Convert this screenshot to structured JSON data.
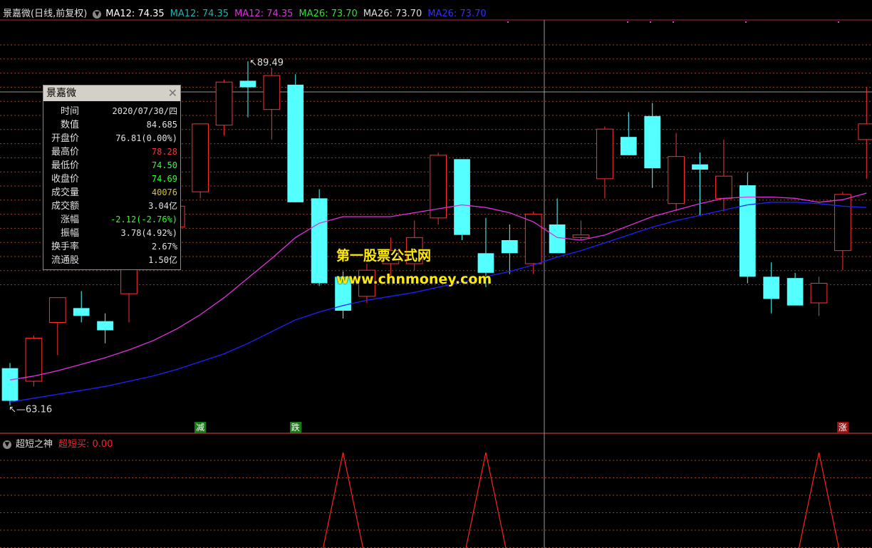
{
  "header": {
    "title": "景嘉微(日线,前复权)",
    "ma12_white": "MA12: 74.35",
    "ma12_teal": "MA12: 74.35",
    "ma12_magenta": "MA12: 74.35",
    "ma26_green": "MA26: 73.70",
    "ma26_white": "MA26: 73.70",
    "ma26_blue": "MA26: 73.70"
  },
  "colors": {
    "up": "#ff3030",
    "down": "#54ffff",
    "ma12": "#e030e0",
    "ma26": "#2020ff",
    "grid": "#9c4020",
    "indicator": "#ff2020"
  },
  "info_panel": {
    "title": "景嘉微",
    "rows": [
      {
        "label": "时间",
        "value": "2020/07/30/四",
        "color": "#e0e0e0"
      },
      {
        "label": "数值",
        "value": "84.685",
        "color": "#e0e0e0"
      },
      {
        "label": "开盘价",
        "value": "76.81(0.00%)",
        "color": "#e0e0e0"
      },
      {
        "label": "最高价",
        "value": "78.28",
        "color": "#ff3030"
      },
      {
        "label": "最低价",
        "value": "74.50",
        "color": "#30ff30"
      },
      {
        "label": "收盘价",
        "value": "74.69",
        "color": "#30ff30"
      },
      {
        "label": "成交量",
        "value": "40076",
        "color": "#e0c020"
      },
      {
        "label": "成交额",
        "value": "3.04亿",
        "color": "#e0e0e0"
      },
      {
        "label": "涨幅",
        "value": "-2.12(-2.76%)",
        "color": "#30ff30"
      },
      {
        "label": "振幅",
        "value": "3.78(4.92%)",
        "color": "#e0e0e0"
      },
      {
        "label": "换手率",
        "value": "2.67%",
        "color": "#e0e0e0"
      },
      {
        "label": "流通股",
        "value": "1.50亿",
        "color": "#e0e0e0"
      }
    ]
  },
  "annotations": {
    "high": "89.49",
    "low": "63.16"
  },
  "signals": [
    {
      "text": "减",
      "bg": "#1a7a1a",
      "index": 8
    },
    {
      "text": "跌",
      "bg": "#1a7a1a",
      "index": 12
    },
    {
      "text": "涨",
      "bg": "#a01010",
      "index": 35
    }
  ],
  "watermark": {
    "line1": "第一股票公式网",
    "line2": "www.chnmoney.com"
  },
  "indicator": {
    "name": "超短之神",
    "signal_label": "超短买: 0.00"
  },
  "chart_data": {
    "type": "candlestick",
    "candles": [
      {
        "o": 66.0,
        "h": 66.4,
        "l": 63.16,
        "c": 63.5
      },
      {
        "o": 65.0,
        "h": 68.5,
        "l": 64.6,
        "c": 68.3
      },
      {
        "o": 69.5,
        "h": 70.1,
        "l": 67.0,
        "c": 71.4
      },
      {
        "o": 70.6,
        "h": 71.9,
        "l": 69.5,
        "c": 70.0
      },
      {
        "o": 69.6,
        "h": 70.2,
        "l": 67.9,
        "c": 68.9
      },
      {
        "o": 71.7,
        "h": 75.0,
        "l": 69.5,
        "c": 74.7
      },
      {
        "o": 75.5,
        "h": 78.8,
        "l": 75.0,
        "c": 75.7
      },
      {
        "o": 76.8,
        "h": 78.3,
        "l": 74.5,
        "c": 78.4
      },
      {
        "o": 79.5,
        "h": 83.8,
        "l": 79.0,
        "c": 84.7
      },
      {
        "o": 84.6,
        "h": 88.1,
        "l": 83.8,
        "c": 87.9
      },
      {
        "o": 88.0,
        "h": 89.49,
        "l": 85.2,
        "c": 87.5
      },
      {
        "o": 85.8,
        "h": 89.0,
        "l": 83.5,
        "c": 88.4
      },
      {
        "o": 87.7,
        "h": 88.5,
        "l": 78.9,
        "c": 78.7
      },
      {
        "o": 79.0,
        "h": 79.7,
        "l": 72.3,
        "c": 72.5
      },
      {
        "o": 73.0,
        "h": 73.4,
        "l": 69.8,
        "c": 70.4
      },
      {
        "o": 71.5,
        "h": 74.0,
        "l": 71.0,
        "c": 73.5
      },
      {
        "o": 74.0,
        "h": 76.0,
        "l": 73.0,
        "c": 75.0
      },
      {
        "o": 74.0,
        "h": 77.3,
        "l": 73.5,
        "c": 76.0
      },
      {
        "o": 77.5,
        "h": 82.5,
        "l": 77.0,
        "c": 82.3
      },
      {
        "o": 82.0,
        "h": 82.0,
        "l": 75.8,
        "c": 76.2
      },
      {
        "o": 74.8,
        "h": 77.5,
        "l": 72.2,
        "c": 73.3
      },
      {
        "o": 75.8,
        "h": 77.0,
        "l": 73.2,
        "c": 74.8
      },
      {
        "o": 74.0,
        "h": 78.0,
        "l": 73.2,
        "c": 77.8
      },
      {
        "o": 77.0,
        "h": 79.0,
        "l": 74.8,
        "c": 74.8
      },
      {
        "o": 76.0,
        "h": 77.3,
        "l": 75.8,
        "c": 76.2
      },
      {
        "o": 80.5,
        "h": 84.5,
        "l": 79.0,
        "c": 84.3
      },
      {
        "o": 83.7,
        "h": 85.6,
        "l": 82.3,
        "c": 82.3
      },
      {
        "o": 85.3,
        "h": 86.3,
        "l": 79.8,
        "c": 81.3
      },
      {
        "o": 78.6,
        "h": 84.0,
        "l": 78.0,
        "c": 82.2
      },
      {
        "o": 81.6,
        "h": 82.5,
        "l": 77.7,
        "c": 81.2
      },
      {
        "o": 79.0,
        "h": 83.5,
        "l": 78.0,
        "c": 80.7
      },
      {
        "o": 80.0,
        "h": 81.0,
        "l": 72.5,
        "c": 73.0
      },
      {
        "o": 73.0,
        "h": 74.1,
        "l": 70.2,
        "c": 71.3
      },
      {
        "o": 72.9,
        "h": 73.3,
        "l": 70.8,
        "c": 70.8
      },
      {
        "o": 71.0,
        "h": 73.0,
        "l": 70.0,
        "c": 72.5
      },
      {
        "o": 75.0,
        "h": 79.5,
        "l": 73.5,
        "c": 79.3
      },
      {
        "o": 83.5,
        "h": 87.5,
        "l": 80.5,
        "c": 84.7
      }
    ],
    "ma12": [
      65.1,
      65.4,
      65.8,
      66.3,
      66.8,
      67.4,
      68.1,
      69.0,
      70.1,
      71.4,
      72.9,
      74.4,
      76.0,
      77.1,
      77.6,
      77.6,
      77.6,
      77.9,
      78.2,
      78.5,
      78.3,
      77.9,
      77.2,
      76.0,
      75.8,
      76.2,
      76.9,
      77.6,
      78.1,
      78.6,
      79.0,
      79.1,
      79.1,
      79.0,
      78.7,
      78.9,
      79.4
    ],
    "ma26": [
      63.4,
      63.7,
      64.0,
      64.3,
      64.6,
      65.0,
      65.4,
      65.9,
      66.5,
      67.1,
      67.9,
      68.8,
      69.7,
      70.3,
      70.8,
      71.2,
      71.5,
      71.8,
      72.2,
      72.6,
      73.0,
      73.4,
      73.9,
      74.5,
      75.0,
      75.6,
      76.2,
      76.8,
      77.3,
      77.7,
      78.1,
      78.5,
      78.7,
      78.7,
      78.6,
      78.4,
      78.3
    ],
    "indicator_series": [
      0,
      0,
      0,
      0,
      0,
      0,
      0,
      0,
      0,
      0,
      0,
      0,
      0,
      0,
      1,
      0,
      0,
      0,
      0,
      0,
      1,
      0,
      0,
      0,
      0,
      0,
      0,
      0,
      0,
      0,
      0,
      0,
      0,
      0,
      1,
      0,
      0
    ],
    "ylim": [
      62,
      92
    ]
  }
}
